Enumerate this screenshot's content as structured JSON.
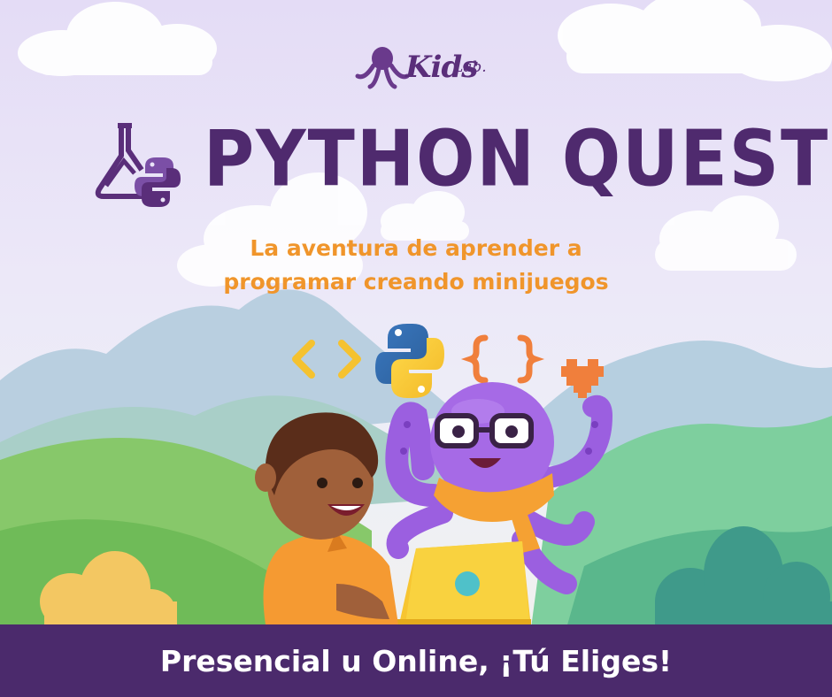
{
  "brand": {
    "name": "Kids",
    "suffix": "Lab."
  },
  "title": "PYTHON QUEST",
  "subtitle": {
    "line1": "La aventura de aprender a",
    "line2": "programar creando minijuegos"
  },
  "banner": {
    "text": "Presencial u Online, ¡Tú Eliges!"
  },
  "icons": [
    "flask-python-icon",
    "angle-brackets-icon",
    "python-logo-icon",
    "curly-braces-icon",
    "pixel-heart-icon"
  ],
  "colors": {
    "brand_purple": "#4b2a6c",
    "subtitle_orange": "#f0952b",
    "octopus_purple": "#9b5fe0",
    "laptop_yellow": "#f7c531",
    "shirt_orange": "#f59a32",
    "hill_green": "#7ec65f"
  }
}
